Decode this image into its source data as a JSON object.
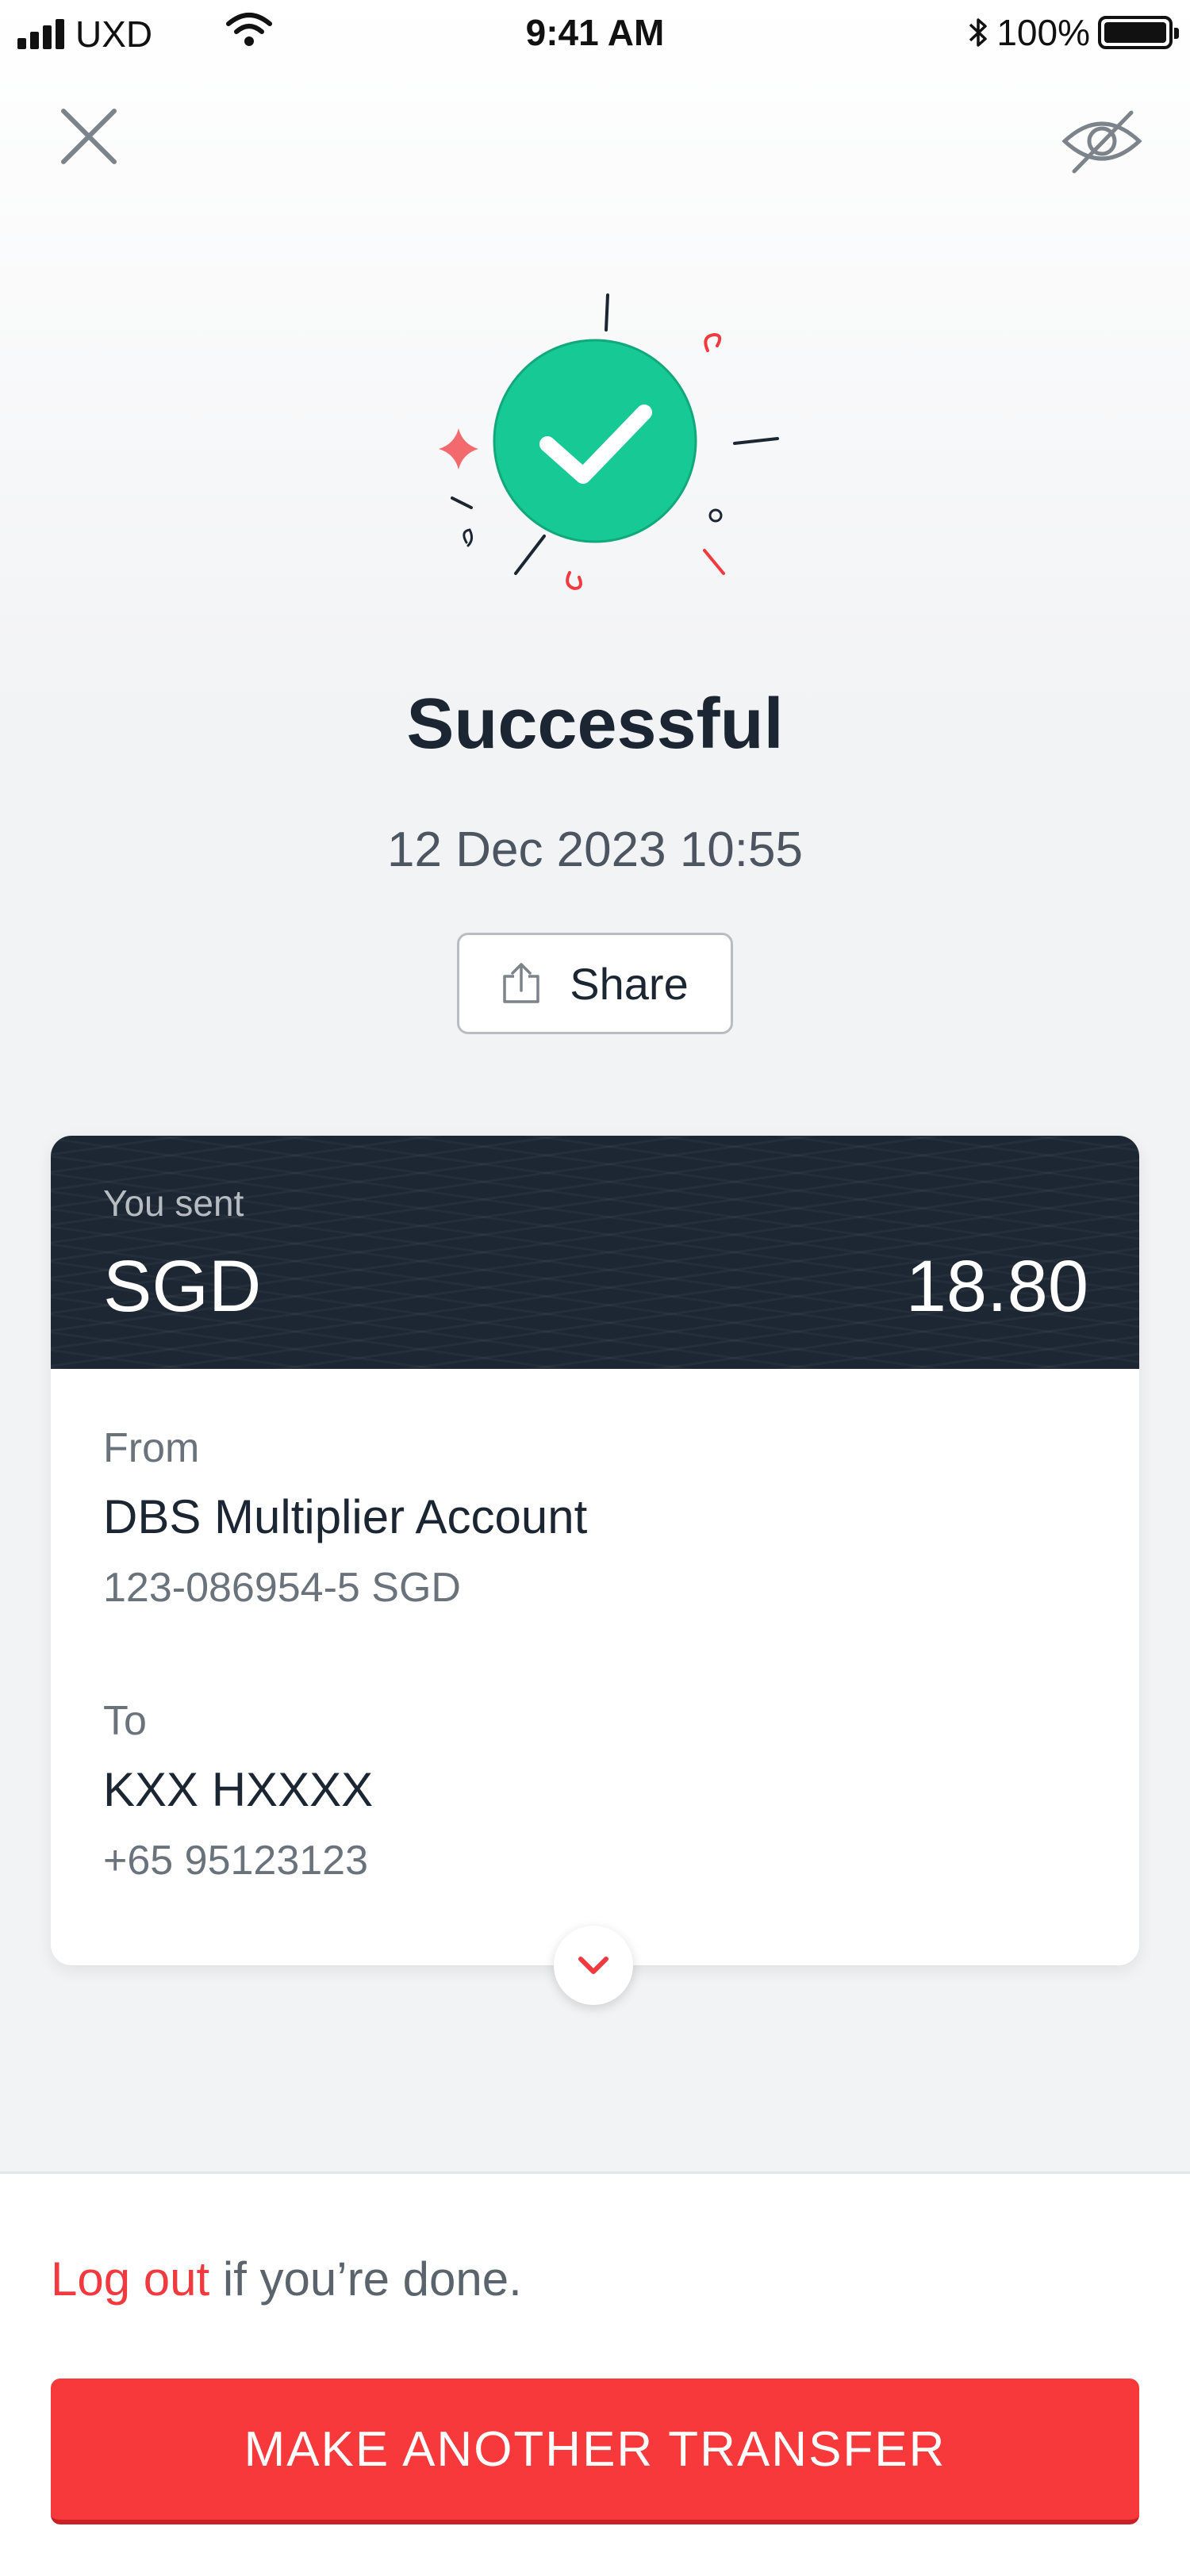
{
  "status_bar": {
    "carrier": "UXD",
    "time": "9:41 AM",
    "battery": "100%"
  },
  "header": {
    "close_icon": "close-icon",
    "visibility_icon": "eye-slash-icon"
  },
  "result": {
    "title": "Successful",
    "datetime": "12 Dec 2023 10:55",
    "share_label": "Share"
  },
  "transfer": {
    "sent_label": "You sent",
    "currency": "SGD",
    "amount": "18.80",
    "from_label": "From",
    "from_name": "DBS Multiplier Account",
    "from_account": "123-086954-5 SGD",
    "to_label": "To",
    "to_name": "KXX HXXXX",
    "to_phone": "+65 95123123"
  },
  "footer": {
    "logout_link": "Log out",
    "logout_rest": "if you’re done.",
    "cta_label": "MAKE ANOTHER TRANSFER"
  },
  "colors": {
    "accent_red": "#f7393b",
    "success_green": "#17c995",
    "card_dark": "#1d2733"
  }
}
